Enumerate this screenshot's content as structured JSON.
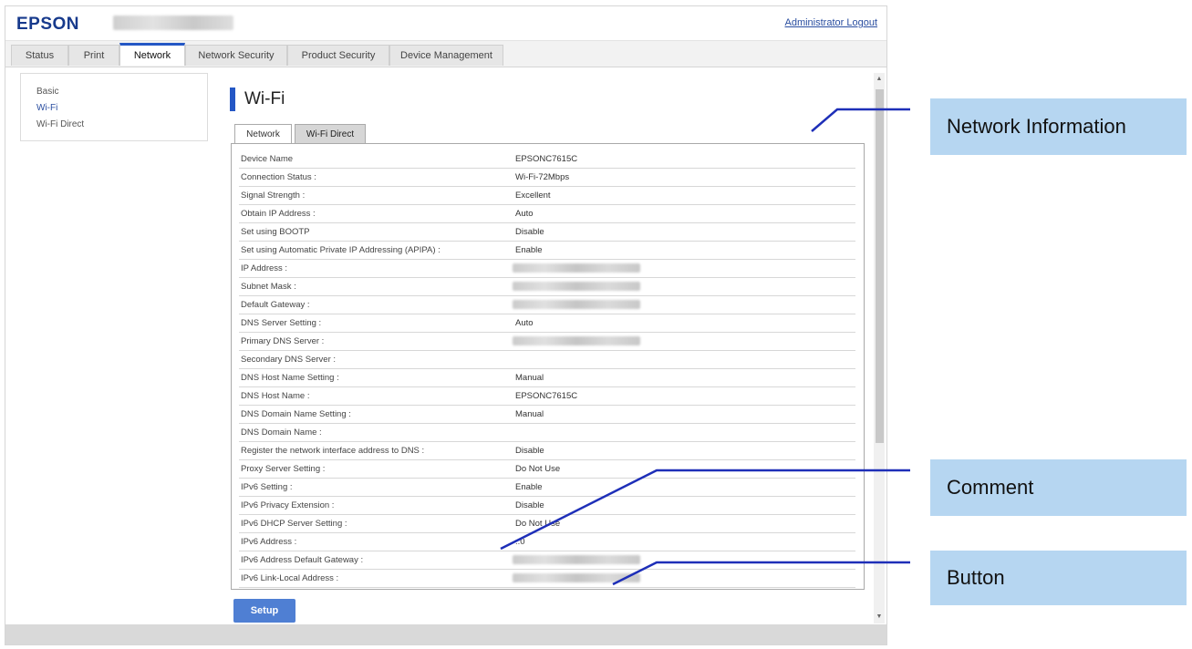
{
  "header": {
    "logo": "EPSON",
    "admin_logout": "Administrator Logout"
  },
  "tabs": [
    {
      "label": "Status"
    },
    {
      "label": "Print"
    },
    {
      "label": "Network",
      "active": true
    },
    {
      "label": "Network Security"
    },
    {
      "label": "Product Security"
    },
    {
      "label": "Device Management"
    }
  ],
  "sidebar": {
    "items": [
      {
        "label": "Basic"
      },
      {
        "label": "Wi-Fi",
        "active": true
      },
      {
        "label": "Wi-Fi Direct"
      }
    ]
  },
  "main": {
    "title": "Wi-Fi",
    "subtabs": [
      {
        "label": "Network",
        "active": true
      },
      {
        "label": "Wi-Fi Direct"
      }
    ],
    "rows": [
      {
        "label": "Device Name",
        "value": "EPSONC7615C"
      },
      {
        "label": "Connection Status :",
        "value": "Wi-Fi-72Mbps"
      },
      {
        "label": "Signal Strength :",
        "value": "Excellent"
      },
      {
        "label": "Obtain IP Address :",
        "value": "Auto"
      },
      {
        "label": "Set using BOOTP",
        "value": "Disable"
      },
      {
        "label": "Set using Automatic Private IP Addressing (APIPA) :",
        "value": "Enable"
      },
      {
        "label": "IP Address :",
        "value": "",
        "blurred": true
      },
      {
        "label": "Subnet Mask :",
        "value": "",
        "blurred": true
      },
      {
        "label": "Default Gateway :",
        "value": "",
        "blurred": true
      },
      {
        "label": "DNS Server Setting :",
        "value": "Auto"
      },
      {
        "label": "Primary DNS Server :",
        "value": "",
        "blurred": true
      },
      {
        "label": "Secondary DNS Server :",
        "value": ""
      },
      {
        "label": "DNS Host Name Setting :",
        "value": "Manual"
      },
      {
        "label": "DNS Host Name :",
        "value": "EPSONC7615C"
      },
      {
        "label": "DNS Domain Name Setting :",
        "value": "Manual"
      },
      {
        "label": "DNS Domain Name :",
        "value": ""
      },
      {
        "label": "Register the network interface address to DNS :",
        "value": "Disable"
      },
      {
        "label": "Proxy Server Setting :",
        "value": "Do Not Use"
      },
      {
        "label": "IPv6 Setting :",
        "value": "Enable"
      },
      {
        "label": "IPv6 Privacy Extension :",
        "value": "Disable"
      },
      {
        "label": "IPv6 DHCP Server Setting :",
        "value": "Do Not Use"
      },
      {
        "label": "IPv6 Address :",
        "value": "::0"
      },
      {
        "label": "IPv6 Address Default Gateway :",
        "value": "",
        "blurred": true
      },
      {
        "label": "IPv6 Link-Local Address :",
        "value": "",
        "blurred": true
      }
    ],
    "setup_button": "Setup"
  },
  "callouts": {
    "network_information": "Network Information",
    "comment": "Comment",
    "button": "Button"
  },
  "colors": {
    "accent": "#2457c5",
    "callout_bg": "#b6d6f1",
    "button_bg": "#4f7fd3",
    "annotation_line": "#1e2fb8"
  }
}
